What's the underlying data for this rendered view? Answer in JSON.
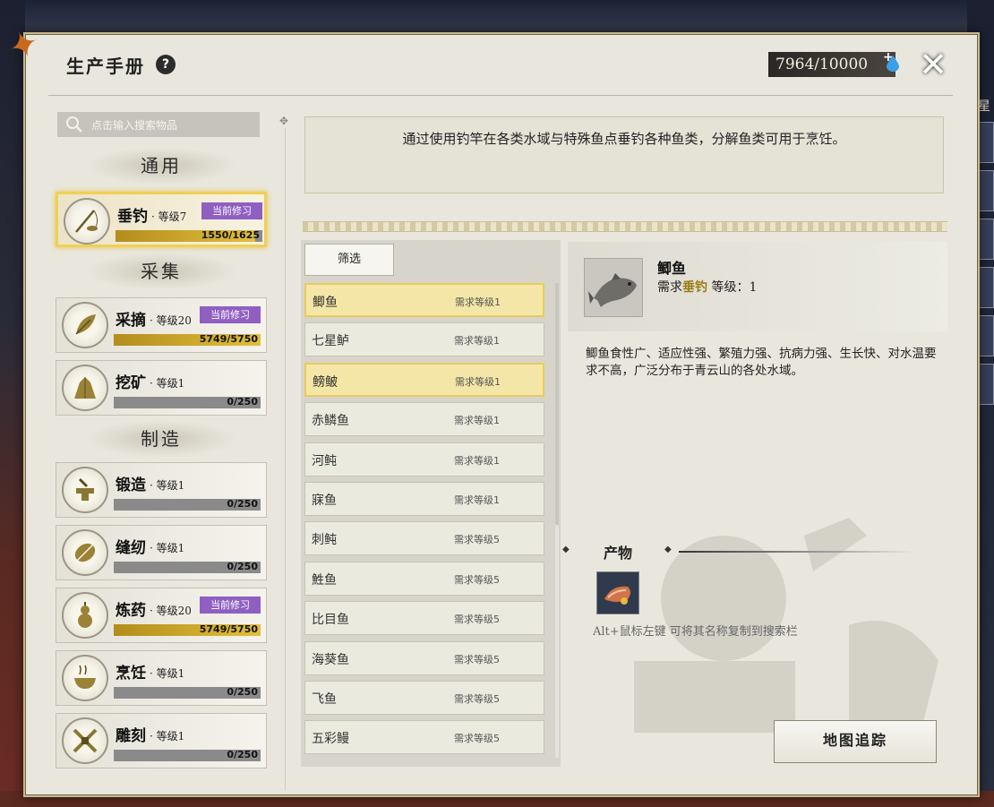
{
  "header": {
    "title": "生产手册",
    "help": "?",
    "points": "7964/10000",
    "points_plus": "+",
    "close": "✕"
  },
  "search": {
    "placeholder": "点击输入搜索物品"
  },
  "categories": {
    "general": "通用",
    "gather": "采集",
    "craft": "制造"
  },
  "skills": [
    {
      "id": "fishing",
      "name": "垂钓",
      "level": "· 等级7",
      "badge": "当前修习",
      "progress_text": "1550/1625",
      "progress": 0.954,
      "icon": "fishing-rod-icon"
    },
    {
      "id": "picking",
      "name": "采摘",
      "level": "· 等级20",
      "badge": "当前修习",
      "progress_text": "5749/5750",
      "progress": 0.999,
      "icon": "leaf-icon"
    },
    {
      "id": "mining",
      "name": "挖矿",
      "level": "· 等级1",
      "badge": "",
      "progress_text": "0/250",
      "progress": 0,
      "icon": "ore-icon"
    },
    {
      "id": "forging",
      "name": "锻造",
      "level": "· 等级1",
      "badge": "",
      "progress_text": "0/250",
      "progress": 0,
      "icon": "anvil-icon"
    },
    {
      "id": "sewing",
      "name": "缝纫",
      "level": "· 等级1",
      "badge": "",
      "progress_text": "0/250",
      "progress": 0,
      "icon": "needle-icon"
    },
    {
      "id": "alchemy",
      "name": "炼药",
      "level": "· 等级20",
      "badge": "当前修习",
      "progress_text": "5749/5750",
      "progress": 0.999,
      "icon": "gourd-icon"
    },
    {
      "id": "cooking",
      "name": "烹饪",
      "level": "· 等级1",
      "badge": "",
      "progress_text": "0/250",
      "progress": 0,
      "icon": "pot-icon"
    },
    {
      "id": "carving",
      "name": "雕刻",
      "level": "· 等级1",
      "badge": "",
      "progress_text": "0/250",
      "progress": 0,
      "icon": "chisel-icon"
    }
  ],
  "description": "通过使用钓竿在各类水域与特殊鱼点垂钓各种鱼类，分解鱼类可用于烹饪。",
  "filter_label": "筛选",
  "fish_list": [
    {
      "name": "鲫鱼",
      "req": "需求等级1",
      "selected": true
    },
    {
      "name": "七星鲈",
      "req": "需求等级1",
      "selected": false
    },
    {
      "name": "鳑鲏",
      "req": "需求等级1",
      "selected": true
    },
    {
      "name": "赤鳞鱼",
      "req": "需求等级1",
      "selected": false
    },
    {
      "name": "河鲀",
      "req": "需求等级1",
      "selected": false
    },
    {
      "name": "寐鱼",
      "req": "需求等级1",
      "selected": false
    },
    {
      "name": "刺鲀",
      "req": "需求等级5",
      "selected": false
    },
    {
      "name": "鮏鱼",
      "req": "需求等级5",
      "selected": false
    },
    {
      "name": "比目鱼",
      "req": "需求等级5",
      "selected": false
    },
    {
      "name": "海葵鱼",
      "req": "需求等级5",
      "selected": false
    },
    {
      "name": "飞鱼",
      "req": "需求等级5",
      "selected": false
    },
    {
      "name": "五彩鳗",
      "req": "需求等级5",
      "selected": false
    }
  ],
  "detail": {
    "name": "鲫鱼",
    "req_prefix": "需求",
    "req_skill": "垂钓",
    "req_suffix": "等级：1",
    "text": "鲫鱼食性广、适应性强、繁殖力强、抗病力强、生长快、对水温要求不高，广泛分布于青云山的各处水域。",
    "products_title": "产物",
    "hint": "Alt+鼠标左键  可将其名称复制到搜索栏",
    "map_button": "地图追踪"
  },
  "side_strip_label": "星",
  "colors": {
    "accent_gold": "#e2bf3a",
    "badge_purple": "#8f5fc2",
    "selected_fill": "#f4e6a6",
    "panel_bg": "#e9e7dd"
  }
}
